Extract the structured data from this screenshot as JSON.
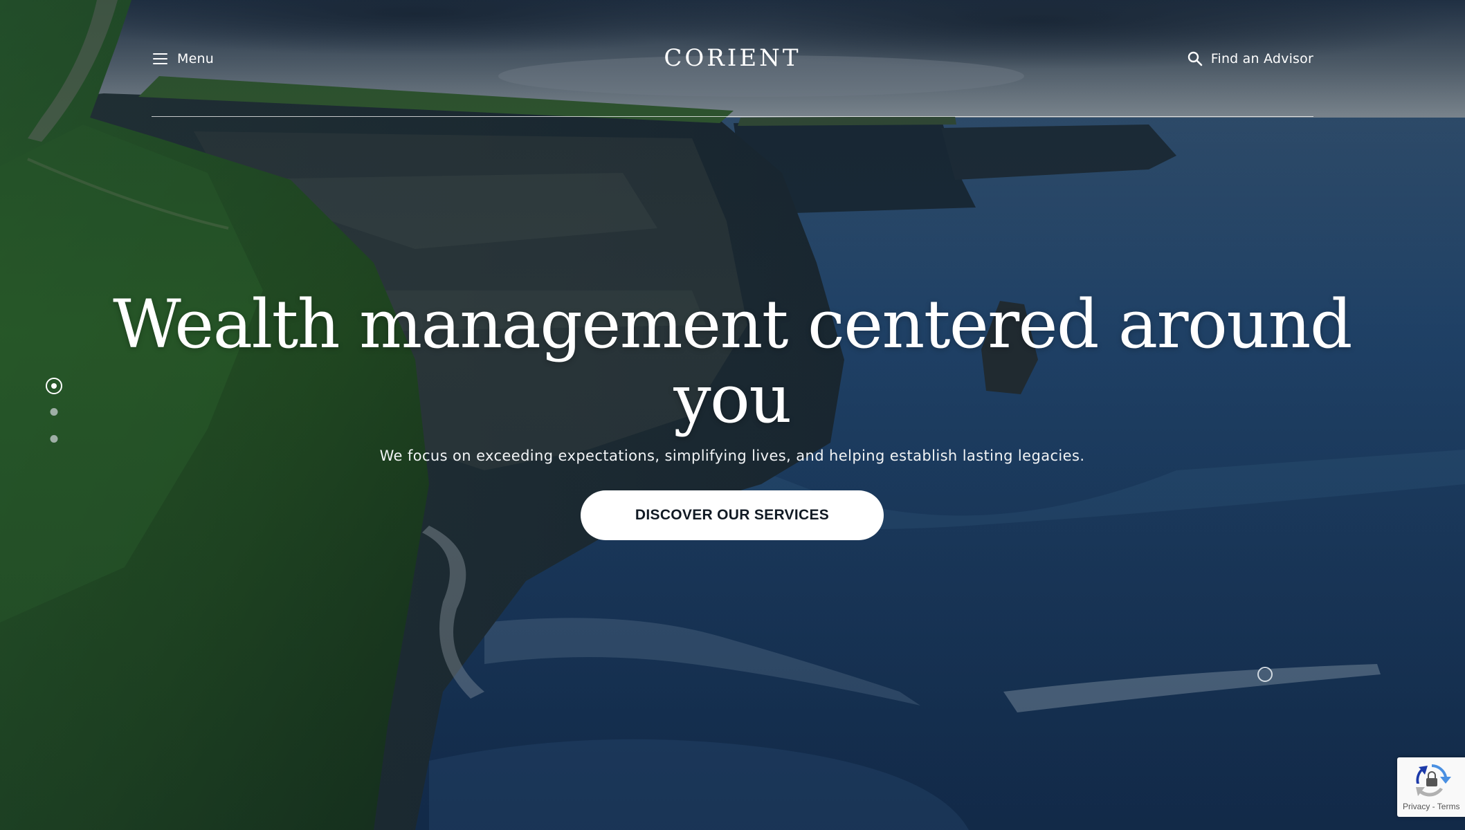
{
  "header": {
    "menu_label": "Menu",
    "menu_icon": "hamburger-icon",
    "logo_text": "CORIENT",
    "advisor_label": "Find an Advisor",
    "advisor_icon": "search-icon"
  },
  "hero": {
    "title": "Wealth management centered around you",
    "subtitle": "We focus on exceeding expectations, simplifying lives, and helping establish lasting legacies.",
    "cta_label": "DISCOVER OUR SERVICES"
  },
  "slider": {
    "slide_count": 3,
    "active_slide": 1
  },
  "recaptcha": {
    "privacy_label": "Privacy",
    "separator": " - ",
    "terms_label": "Terms",
    "icon": "recaptcha-icon"
  },
  "colors": {
    "cta_background": "#ffffff",
    "cta_text": "#111a24",
    "overlay_text": "#ffffff",
    "sea": "#1d3d63",
    "cliff_green": "#2f5f2a"
  }
}
